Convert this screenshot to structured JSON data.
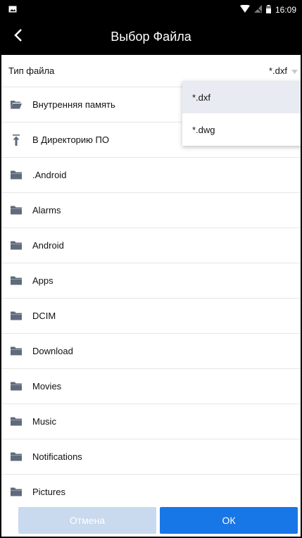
{
  "status": {
    "time": "16:09"
  },
  "appbar": {
    "title": "Выбор Файла"
  },
  "filetype": {
    "label": "Тип файла",
    "value": "*.dxf"
  },
  "dropdown": {
    "options": [
      "*.dxf",
      "*.dwg"
    ]
  },
  "list": {
    "items": [
      {
        "label": "Внутренняя память",
        "icon": "folder-open-icon"
      },
      {
        "label": "В Директорию ПО",
        "icon": "upload-to-top-icon"
      },
      {
        "label": ".Android",
        "icon": "folder-icon"
      },
      {
        "label": "Alarms",
        "icon": "folder-icon"
      },
      {
        "label": "Android",
        "icon": "folder-icon"
      },
      {
        "label": "Apps",
        "icon": "folder-icon"
      },
      {
        "label": "DCIM",
        "icon": "folder-icon"
      },
      {
        "label": "Download",
        "icon": "folder-icon"
      },
      {
        "label": "Movies",
        "icon": "folder-icon"
      },
      {
        "label": "Music",
        "icon": "folder-icon"
      },
      {
        "label": "Notifications",
        "icon": "folder-icon"
      },
      {
        "label": "Pictures",
        "icon": "folder-icon"
      }
    ]
  },
  "buttons": {
    "cancel": "Отмена",
    "ok": "ОК"
  },
  "colors": {
    "accent": "#1877e6",
    "cancel_bg": "#c9d9ee",
    "bar": "#000000"
  }
}
